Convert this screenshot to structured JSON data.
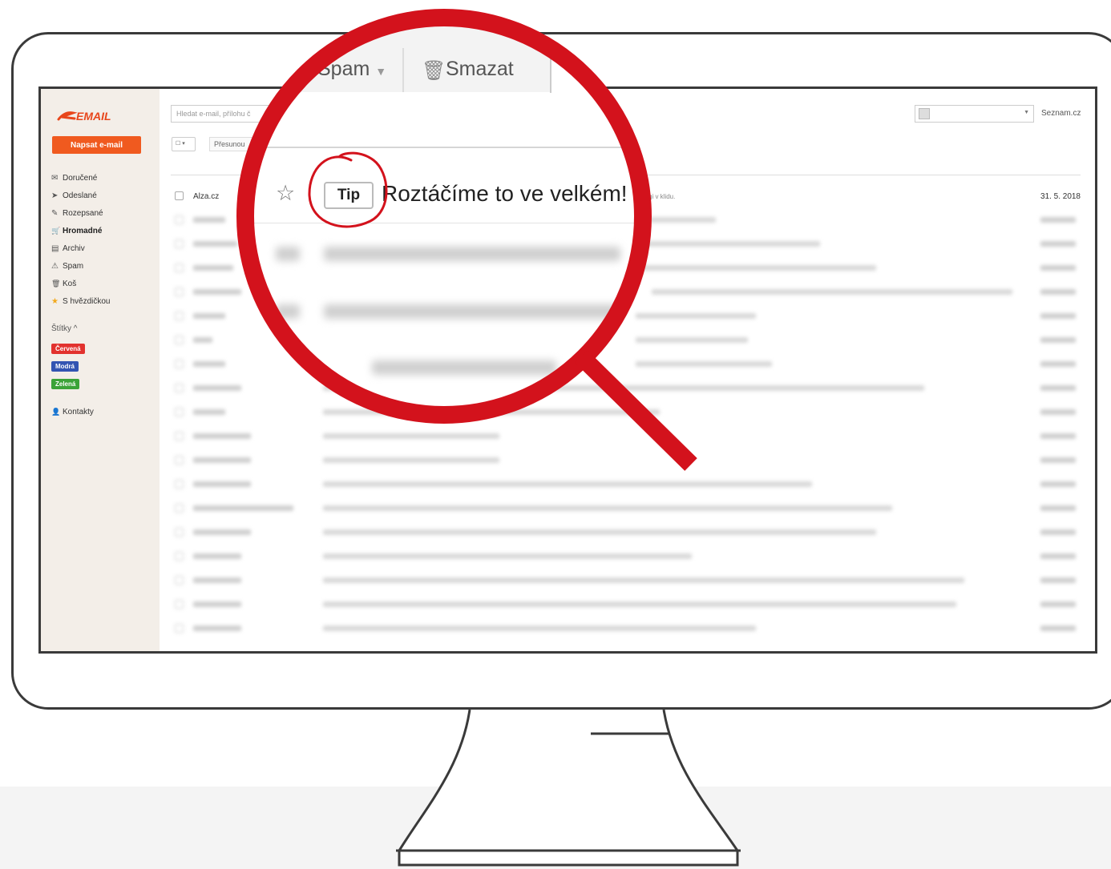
{
  "app": {
    "logo_text": "EMAIL",
    "compose_label": "Napsat e-mail",
    "search_placeholder": "Hledat e-mail, přílohu č",
    "move_label": "Přesunou",
    "seznam_label": "Seznam.cz"
  },
  "sidebar": {
    "items": [
      {
        "icon": "✉",
        "icon_name": "envelope-icon",
        "label": "Doručené"
      },
      {
        "icon": "➤",
        "icon_name": "send-icon",
        "label": "Odeslané"
      },
      {
        "icon": "✎",
        "icon_name": "draft-icon",
        "label": "Rozepsané"
      },
      {
        "icon": "🛒",
        "icon_name": "cart-icon",
        "label": "Hromadné"
      },
      {
        "icon": "▤",
        "icon_name": "archive-icon",
        "label": "Archiv"
      },
      {
        "icon": "⚠",
        "icon_name": "warning-icon",
        "label": "Spam"
      },
      {
        "icon": "🗑",
        "icon_name": "trash-icon",
        "label": "Koš"
      },
      {
        "icon": "★",
        "icon_name": "star-icon",
        "label": "S hvězdičkou"
      }
    ],
    "tags_title": "Štítky ^",
    "tags": [
      {
        "label": "Červená",
        "color": "#e2322e"
      },
      {
        "label": "Modrá",
        "color": "#3354b2"
      },
      {
        "label": "Zelená",
        "color": "#3ba338"
      }
    ],
    "contacts_label": "Kontakty"
  },
  "emails": {
    "first": {
      "sender": "Alza.cz",
      "snippet": "gi v klidu.",
      "date": "31. 5. 2018"
    }
  },
  "magnifier": {
    "toolbar_spam": "Spam",
    "toolbar_smazat": "Smazat",
    "tip_label": "Tip",
    "subject": "Roztáčíme to ve velkém!",
    "ring_color": "#d3121c",
    "star": "☆"
  }
}
